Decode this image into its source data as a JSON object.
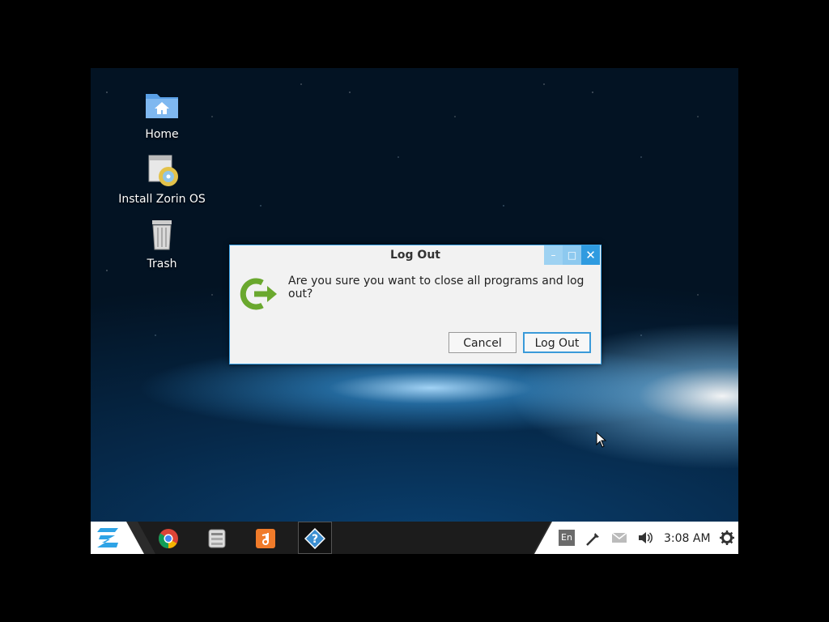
{
  "desktop": {
    "icons": [
      {
        "label": "Home",
        "icon": "home-folder-icon"
      },
      {
        "label": "Install Zorin OS",
        "icon": "install-disc-icon"
      },
      {
        "label": "Trash",
        "icon": "trash-icon"
      }
    ]
  },
  "dialog": {
    "title": "Log Out",
    "message": "Are you sure you want to close all programs and log out?",
    "buttons": {
      "cancel": "Cancel",
      "logout": "Log Out"
    },
    "window_controls": {
      "minimize": "–",
      "maximize": "□",
      "close": "✕"
    },
    "accent": "#3da5e8"
  },
  "taskbar": {
    "apps": [
      "zorin-menu-icon",
      "chrome-icon",
      "file-manager-icon",
      "music-icon",
      "help-icon"
    ],
    "tray": {
      "keyboard_layout": "En",
      "clock": "3:08 AM"
    }
  }
}
